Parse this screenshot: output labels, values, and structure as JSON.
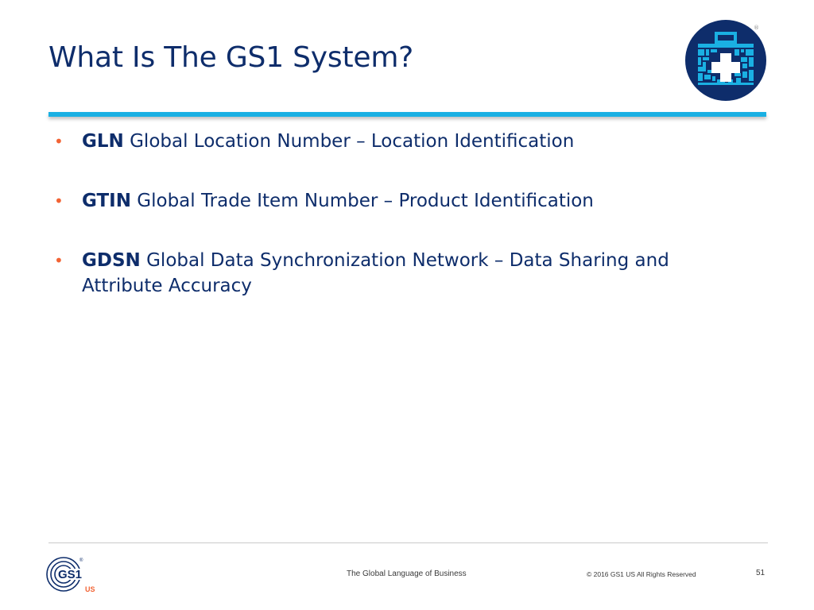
{
  "slide": {
    "title": "What Is The GS1 System?",
    "bullets": [
      {
        "term": "GLN",
        "text": " Global Location Number – Location Identification"
      },
      {
        "term": "GTIN",
        "text": " Global Trade Item Number – Product Identification"
      },
      {
        "term": "GDSN",
        "text": " Global Data Synchronization Network – Data Sharing and Attribute Accuracy"
      }
    ],
    "bullet_symbol": "•"
  },
  "badge": {
    "icon": "healthcare-barcode-briefcase-icon",
    "registered": "®"
  },
  "footer": {
    "logo_text": "GS1",
    "logo_region": "US",
    "logo_registered": "®",
    "tagline": "The Global Language of Business",
    "copyright": "© 2016 GS1 US All Rights Reserved",
    "page_number": "51"
  },
  "colors": {
    "title": "#0e2d6b",
    "accent_rule": "#1ab0e3",
    "bullet": "#f26334",
    "badge_background": "#0e2d6b",
    "badge_pattern": "#1ab0e3"
  }
}
